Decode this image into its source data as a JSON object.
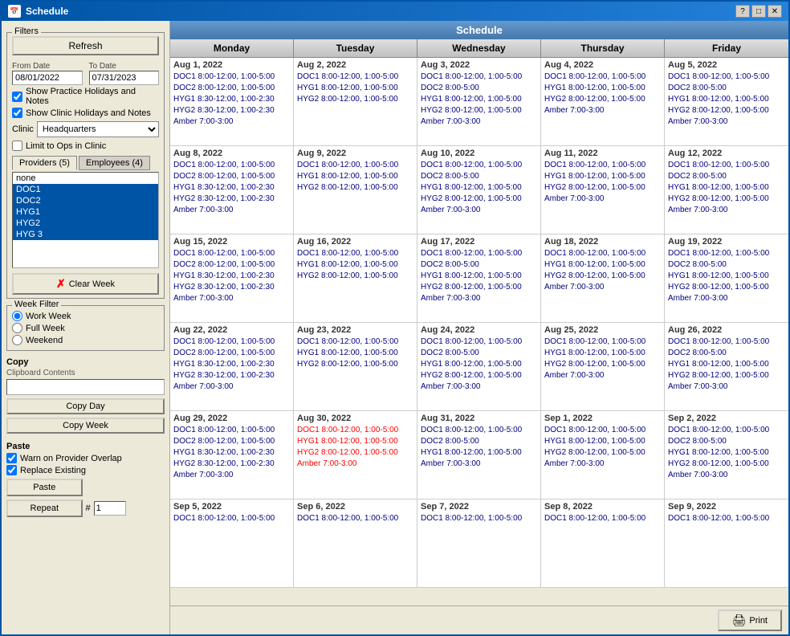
{
  "window": {
    "title": "Schedule",
    "icon": "📅"
  },
  "filters": {
    "label": "Filters",
    "refresh_btn": "Refresh",
    "from_date_label": "From Date",
    "from_date_value": "08/01/2022",
    "to_date_label": "To Date",
    "to_date_value": "07/31/2023",
    "show_practice_holidays": "Show Practice Holidays and Notes",
    "show_clinic_holidays": "Show Clinic Holidays and Notes",
    "clinic_label": "Clinic",
    "clinic_value": "Headquarters",
    "limit_ops": "Limit to Ops in Clinic"
  },
  "providers_tab": "Providers (5)",
  "employees_tab": "Employees (4)",
  "provider_items": [
    {
      "id": "none",
      "label": "none",
      "selected": false
    },
    {
      "id": "doc1",
      "label": "DOC1",
      "selected": true
    },
    {
      "id": "doc2",
      "label": "DOC2",
      "selected": true
    },
    {
      "id": "hyg1",
      "label": "HYG1",
      "selected": true
    },
    {
      "id": "hyg2",
      "label": "HYG2",
      "selected": true
    },
    {
      "id": "hyg3",
      "label": "HYG 3",
      "selected": true
    }
  ],
  "clear_week_btn": "Clear Week",
  "week_filter": {
    "label": "Week Filter",
    "options": [
      "Work Week",
      "Full Week",
      "Weekend"
    ],
    "selected": "Work Week"
  },
  "copy": {
    "label": "Copy",
    "clipboard_label": "Clipboard Contents",
    "clipboard_value": "",
    "copy_day_btn": "Copy Day",
    "copy_week_btn": "Copy Week"
  },
  "paste": {
    "label": "Paste",
    "warn_provider_overlap": "Warn on Provider Overlap",
    "replace_existing": "Replace Existing",
    "paste_btn": "Paste",
    "repeat_btn": "Repeat",
    "repeat_hash": "#",
    "repeat_value": "1"
  },
  "schedule": {
    "title": "Schedule",
    "columns": [
      "Monday",
      "Tuesday",
      "Wednesday",
      "Thursday",
      "Friday"
    ],
    "rows": [
      {
        "cells": [
          {
            "date": "Aug 1, 2022",
            "events": [
              "DOC1 8:00-12:00, 1:00-5:00",
              "DOC2 8:00-12:00, 1:00-5:00",
              "HYG1 8:30-12:00, 1:00-2:30",
              "HYG2 8:30-12:00, 1:00-2:30",
              "Amber 7:00-3:00"
            ],
            "red_events": []
          },
          {
            "date": "Aug 2, 2022",
            "events": [
              "DOC1 8:00-12:00, 1:00-5:00",
              "HYG1 8:00-12:00, 1:00-5:00",
              "HYG2 8:00-12:00, 1:00-5:00"
            ],
            "red_events": []
          },
          {
            "date": "Aug 3, 2022",
            "events": [
              "DOC1 8:00-12:00, 1:00-5:00",
              "DOC2 8:00-5:00",
              "HYG1 8:00-12:00, 1:00-5:00",
              "HYG2 8:00-12:00, 1:00-5:00",
              "Amber 7:00-3:00"
            ],
            "red_events": []
          },
          {
            "date": "Aug 4, 2022",
            "events": [
              "DOC1 8:00-12:00, 1:00-5:00",
              "HYG1 8:00-12:00, 1:00-5:00",
              "HYG2 8:00-12:00, 1:00-5:00",
              "Amber 7:00-3:00"
            ],
            "red_events": []
          },
          {
            "date": "Aug 5, 2022",
            "events": [
              "DOC1 8:00-12:00, 1:00-5:00",
              "DOC2 8:00-5:00",
              "HYG1 8:00-12:00, 1:00-5:00",
              "HYG2 8:00-12:00, 1:00-5:00",
              "Amber 7:00-3:00"
            ],
            "red_events": []
          }
        ]
      },
      {
        "cells": [
          {
            "date": "Aug 8, 2022",
            "events": [
              "DOC1 8:00-12:00, 1:00-5:00",
              "DOC2 8:00-12:00, 1:00-5:00",
              "HYG1 8:30-12:00, 1:00-2:30",
              "HYG2 8:30-12:00, 1:00-2:30",
              "Amber 7:00-3:00"
            ],
            "red_events": []
          },
          {
            "date": "Aug 9, 2022",
            "events": [
              "DOC1 8:00-12:00, 1:00-5:00",
              "HYG1 8:00-12:00, 1:00-5:00",
              "HYG2 8:00-12:00, 1:00-5:00"
            ],
            "red_events": []
          },
          {
            "date": "Aug 10, 2022",
            "events": [
              "DOC1 8:00-12:00, 1:00-5:00",
              "DOC2 8:00-5:00",
              "HYG1 8:00-12:00, 1:00-5:00",
              "HYG2 8:00-12:00, 1:00-5:00",
              "Amber 7:00-3:00"
            ],
            "red_events": []
          },
          {
            "date": "Aug 11, 2022",
            "events": [
              "DOC1 8:00-12:00, 1:00-5:00",
              "HYG1 8:00-12:00, 1:00-5:00",
              "HYG2 8:00-12:00, 1:00-5:00",
              "Amber 7:00-3:00"
            ],
            "red_events": []
          },
          {
            "date": "Aug 12, 2022",
            "events": [
              "DOC1 8:00-12:00, 1:00-5:00",
              "DOC2 8:00-5:00",
              "HYG1 8:00-12:00, 1:00-5:00",
              "HYG2 8:00-12:00, 1:00-5:00",
              "Amber 7:00-3:00"
            ],
            "red_events": []
          }
        ]
      },
      {
        "cells": [
          {
            "date": "Aug 15, 2022",
            "events": [
              "DOC1 8:00-12:00, 1:00-5:00",
              "DOC2 8:00-12:00, 1:00-5:00",
              "HYG1 8:30-12:00, 1:00-2:30",
              "HYG2 8:30-12:00, 1:00-2:30",
              "Amber 7:00-3:00"
            ],
            "red_events": []
          },
          {
            "date": "Aug 16, 2022",
            "events": [
              "DOC1 8:00-12:00, 1:00-5:00",
              "HYG1 8:00-12:00, 1:00-5:00",
              "HYG2 8:00-12:00, 1:00-5:00"
            ],
            "red_events": []
          },
          {
            "date": "Aug 17, 2022",
            "events": [
              "DOC1 8:00-12:00, 1:00-5:00",
              "DOC2 8:00-5:00",
              "HYG1 8:00-12:00, 1:00-5:00",
              "HYG2 8:00-12:00, 1:00-5:00",
              "Amber 7:00-3:00"
            ],
            "red_events": []
          },
          {
            "date": "Aug 18, 2022",
            "events": [
              "DOC1 8:00-12:00, 1:00-5:00",
              "HYG1 8:00-12:00, 1:00-5:00",
              "HYG2 8:00-12:00, 1:00-5:00",
              "Amber 7:00-3:00"
            ],
            "red_events": []
          },
          {
            "date": "Aug 19, 2022",
            "events": [
              "DOC1 8:00-12:00, 1:00-5:00",
              "DOC2 8:00-5:00",
              "HYG1 8:00-12:00, 1:00-5:00",
              "HYG2 8:00-12:00, 1:00-5:00",
              "Amber 7:00-3:00"
            ],
            "red_events": []
          }
        ]
      },
      {
        "cells": [
          {
            "date": "Aug 22, 2022",
            "events": [
              "DOC1 8:00-12:00, 1:00-5:00",
              "DOC2 8:00-12:00, 1:00-5:00",
              "HYG1 8:30-12:00, 1:00-2:30",
              "HYG2 8:30-12:00, 1:00-2:30",
              "Amber 7:00-3:00"
            ],
            "red_events": []
          },
          {
            "date": "Aug 23, 2022",
            "events": [
              "DOC1 8:00-12:00, 1:00-5:00",
              "HYG1 8:00-12:00, 1:00-5:00",
              "HYG2 8:00-12:00, 1:00-5:00"
            ],
            "red_events": []
          },
          {
            "date": "Aug 24, 2022",
            "events": [
              "DOC1 8:00-12:00, 1:00-5:00",
              "DOC2 8:00-5:00",
              "HYG1 8:00-12:00, 1:00-5:00",
              "HYG2 8:00-12:00, 1:00-5:00",
              "Amber 7:00-3:00"
            ],
            "red_events": []
          },
          {
            "date": "Aug 25, 2022",
            "events": [
              "DOC1 8:00-12:00, 1:00-5:00",
              "HYG1 8:00-12:00, 1:00-5:00",
              "HYG2 8:00-12:00, 1:00-5:00",
              "Amber 7:00-3:00"
            ],
            "red_events": []
          },
          {
            "date": "Aug 26, 2022",
            "events": [
              "DOC1 8:00-12:00, 1:00-5:00",
              "DOC2 8:00-5:00",
              "HYG1 8:00-12:00, 1:00-5:00",
              "HYG2 8:00-12:00, 1:00-5:00",
              "Amber 7:00-3:00"
            ],
            "red_events": []
          }
        ]
      },
      {
        "cells": [
          {
            "date": "Aug 29, 2022",
            "events": [
              "DOC1 8:00-12:00, 1:00-5:00",
              "DOC2 8:00-12:00, 1:00-5:00",
              "HYG1 8:30-12:00, 1:00-2:30",
              "HYG2 8:30-12:00, 1:00-2:30",
              "Amber 7:00-3:00"
            ],
            "red_events": []
          },
          {
            "date": "Aug 30, 2022",
            "events": [],
            "red_events": [
              "DOC1 8:00-12:00, 1:00-5:00",
              "HYG1 8:00-12:00, 1:00-5:00",
              "HYG2 8:00-12:00, 1:00-5:00",
              "Amber 7:00-3:00"
            ]
          },
          {
            "date": "Aug 31, 2022",
            "events": [
              "DOC1 8:00-12:00, 1:00-5:00",
              "DOC2 8:00-5:00",
              "HYG1 8:00-12:00, 1:00-5:00",
              "Amber 7:00-3:00"
            ],
            "red_events": []
          },
          {
            "date": "Sep 1, 2022",
            "events": [
              "DOC1 8:00-12:00, 1:00-5:00",
              "HYG1 8:00-12:00, 1:00-5:00",
              "HYG2 8:00-12:00, 1:00-5:00",
              "Amber 7:00-3:00"
            ],
            "red_events": []
          },
          {
            "date": "Sep 2, 2022",
            "events": [
              "DOC1 8:00-12:00, 1:00-5:00",
              "DOC2 8:00-5:00",
              "HYG1 8:00-12:00, 1:00-5:00",
              "HYG2 8:00-12:00, 1:00-5:00",
              "Amber 7:00-3:00"
            ],
            "red_events": []
          }
        ]
      },
      {
        "cells": [
          {
            "date": "Sep 5, 2022",
            "events": [
              "DOC1 8:00-12:00, 1:00-5:00"
            ],
            "red_events": []
          },
          {
            "date": "Sep 6, 2022",
            "events": [
              "DOC1 8:00-12:00, 1:00-5:00"
            ],
            "red_events": []
          },
          {
            "date": "Sep 7, 2022",
            "events": [
              "DOC1 8:00-12:00, 1:00-5:00"
            ],
            "red_events": []
          },
          {
            "date": "Sep 8, 2022",
            "events": [
              "DOC1 8:00-12:00, 1:00-5:00"
            ],
            "red_events": []
          },
          {
            "date": "Sep 9, 2022",
            "events": [
              "DOC1 8:00-12:00, 1:00-5:00"
            ],
            "red_events": []
          }
        ]
      }
    ]
  },
  "print_btn": "Print"
}
